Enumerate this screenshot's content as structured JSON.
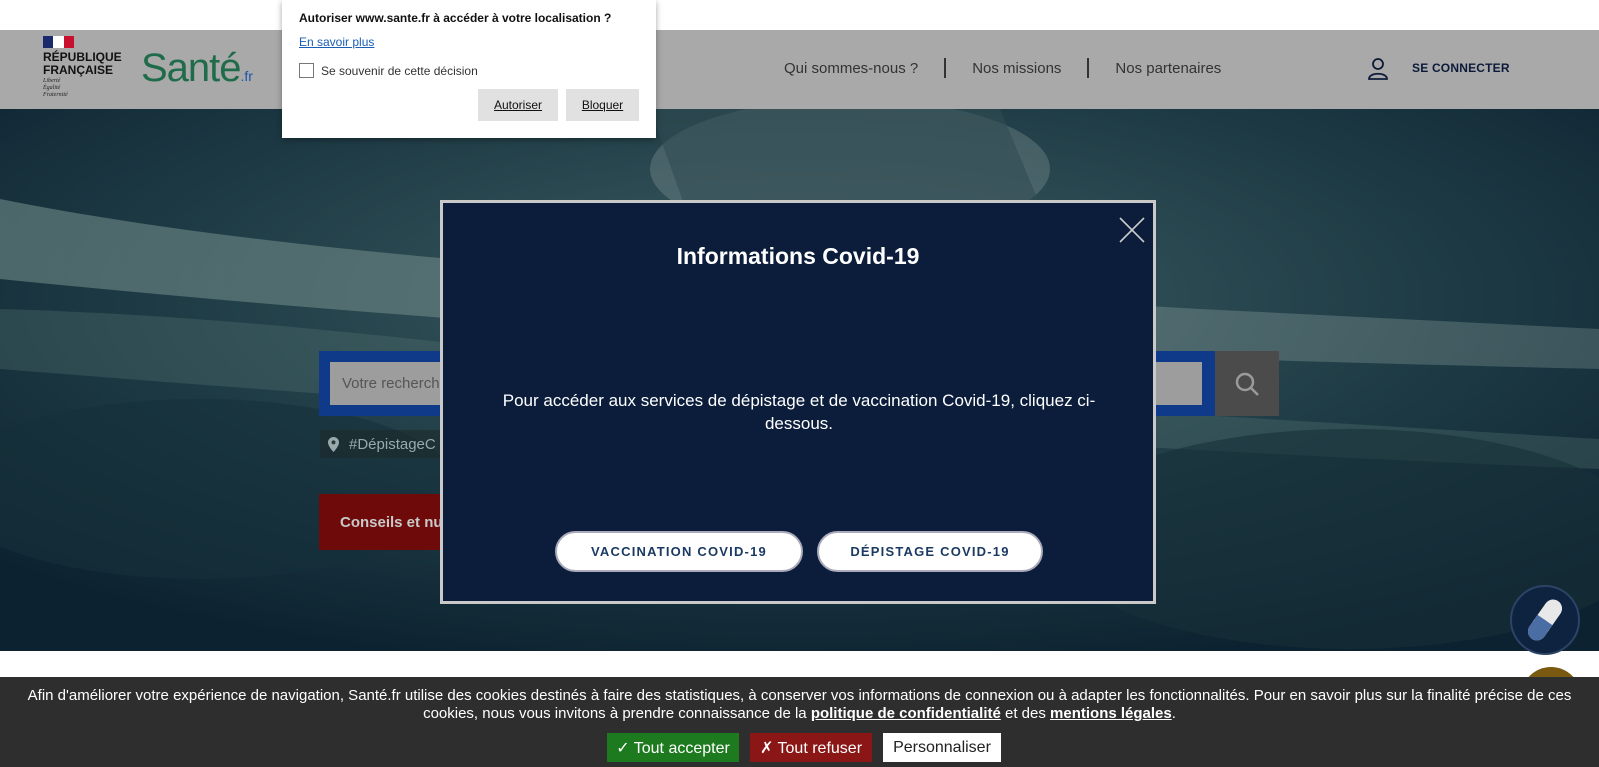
{
  "geolocation_prompt": {
    "title": "Autoriser www.sante.fr à accéder à votre localisation ?",
    "learn_more": "En savoir plus",
    "remember": "Se souvenir de cette décision",
    "allow": "Autoriser",
    "block": "Bloquer"
  },
  "header": {
    "rf_text": "RÉPUBLIQUE FRANÇAISE",
    "rf_motto": "Liberté Égalité Fraternité",
    "brand": "Santé",
    "brand_suffix": ".fr",
    "nav": [
      "Qui sommes-nous ?",
      "Nos missions",
      "Nos partenaires"
    ],
    "login_label": "SE CONNECTER"
  },
  "search": {
    "placeholder": "Votre recherch",
    "location_tag": "#DépistageC"
  },
  "conseils_label": "Conseils et nu",
  "modal": {
    "title": "Informations Covid-19",
    "text": "Pour accéder aux services de dépistage et de vaccination Covid-19, cliquez ci-dessous.",
    "btn_vaccination": "VACCINATION COVID-19",
    "btn_depistage": "DÉPISTAGE COVID-19"
  },
  "cookie": {
    "text_part1": "Afin d'améliorer votre expérience de navigation, Santé.fr utilise des cookies destinés à faire des statistiques, à conserver vos informations de connexion ou à adapter les fonctionnalités. Pour en savoir plus sur la finalité précise de ces cookies, nous vous invitons à prendre connaissance de la ",
    "link_privacy": "politique de confidentialité",
    "text_part2": " et des ",
    "link_legal": "mentions légales",
    "text_part3": ".",
    "accept": "✓ Tout accepter",
    "refuse": "✗ Tout refuser",
    "customize": "Personnaliser"
  },
  "colors": {
    "modal_bg": "#0b1d3b",
    "cookie_bg": "#2e2e2e",
    "accept_green": "#1e7a1e",
    "refuse_red": "#8a1616"
  }
}
